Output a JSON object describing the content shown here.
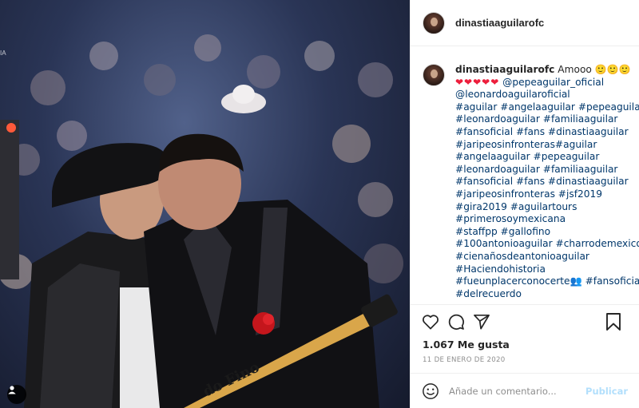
{
  "post": {
    "username": "dinastiaaguilarofc",
    "caption": {
      "user": "dinastiaaguilarofc",
      "intro": "Amooo",
      "intro_emoji": "🙂🙂🙂",
      "hearts": "❤❤❤❤❤",
      "lines": [
        "@pepeaguilar_oficial",
        "@leonardoaguilaroficial",
        "#aguilar #angelaaguilar #pepeaguilar",
        "#leonardoaguilar #familiaaguilar",
        "#fansoficial #fans #dinastiaaguilar",
        "#jaripeosinfronteras#aguilar",
        "#angelaaguilar #pepeaguilar",
        "#leonardoaguilar #familiaaguilar",
        "#fansoficial #fans #dinastiaaguilar",
        "#jaripeosinfronteras #jsf2019",
        "#gira2019 #aguilartours",
        "#primerosoymexicana",
        "#staffpp #gallofino",
        "#100antonioaguilar #charrodemexico",
        "#cienañosdeantonioaguilar",
        "#Haciendohistoria",
        "#fueunplacerconocerte👥 #fansoficial",
        "#delrecuerdo"
      ]
    },
    "likes": "1.067 Me gusta",
    "date": "11 DE ENERO DE 2020",
    "comment_placeholder": "Añade un comentario...",
    "publish_label": "Publicar",
    "photo_text": "do Fino",
    "watermark": "IA"
  },
  "icons": {
    "like": "heart-icon",
    "comment": "comment-icon",
    "share": "share-icon",
    "save": "bookmark-icon",
    "emoji": "smiley-icon",
    "user_tag": "user-tag-icon"
  },
  "colors": {
    "link": "#00376b",
    "publish_disabled": "#b2dffc",
    "muted": "#8e8e8e",
    "border": "#efefef"
  }
}
